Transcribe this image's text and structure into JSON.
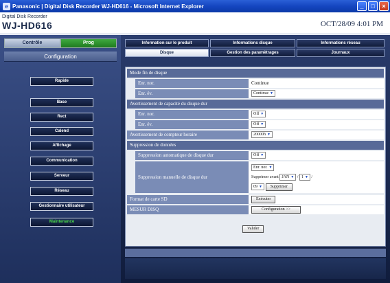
{
  "window": {
    "title": "Panasonic | Digital Disk Recorder WJ-HD616 - Microsoft Internet Explorer"
  },
  "header": {
    "brand_sub": "Digital Disk Recorder",
    "model": "WJ-HD616",
    "datetime": "OCT/28/09 4:01 PM"
  },
  "left": {
    "mode_tabs": [
      "Contrôle",
      "Prog"
    ],
    "config_title": "Configuration",
    "menu": [
      "Rapide",
      "Base",
      "Rect",
      "Calend",
      "Affichage",
      "Communication",
      "Serveur",
      "Réseau",
      "Gestionnaire utilisateur",
      "Maintenance"
    ]
  },
  "tabs": {
    "row1": [
      "Information sur le produit",
      "Informations disque",
      "Informations réseau"
    ],
    "row2": [
      "Disque",
      "Gestion des paramètrages",
      "Journaux"
    ]
  },
  "form": {
    "s1": "Mode fin de disque",
    "enr_nor": "Enr. nor.",
    "enr_nor_val": "Continue",
    "enr_ev": "Enr. év.",
    "enr_ev_val": "Continue",
    "s2": "Avertissement de capacité du disque dur",
    "enr_nor2": "Enr. nor.",
    "enr_nor2_val": "Off",
    "enr_ev2": "Enr. év.",
    "enr_ev2_val": "Off",
    "counter": "Avertissement de compteur horaire",
    "counter_val": "20000h",
    "s3": "Suppression de données",
    "auto_del": "Suppression automatique de disque dur",
    "auto_del_val": "Off",
    "manual_del": "Suppression manuelle de disque dur",
    "manual_del_sel": "Enr. nor.",
    "del_before": "Supprimer avant",
    "month": "JAN",
    "day": "1",
    "year": "09",
    "delete_btn": "Supprimer",
    "sd_format": "Format de carte SD",
    "execute_btn": "Exécuter",
    "mesure": "MESUR DISQ",
    "config_btn": "Configuration >>",
    "validate_btn": "Valider"
  },
  "colors": {
    "accent_green": "#49d749",
    "title_blue": "#1546c0"
  }
}
